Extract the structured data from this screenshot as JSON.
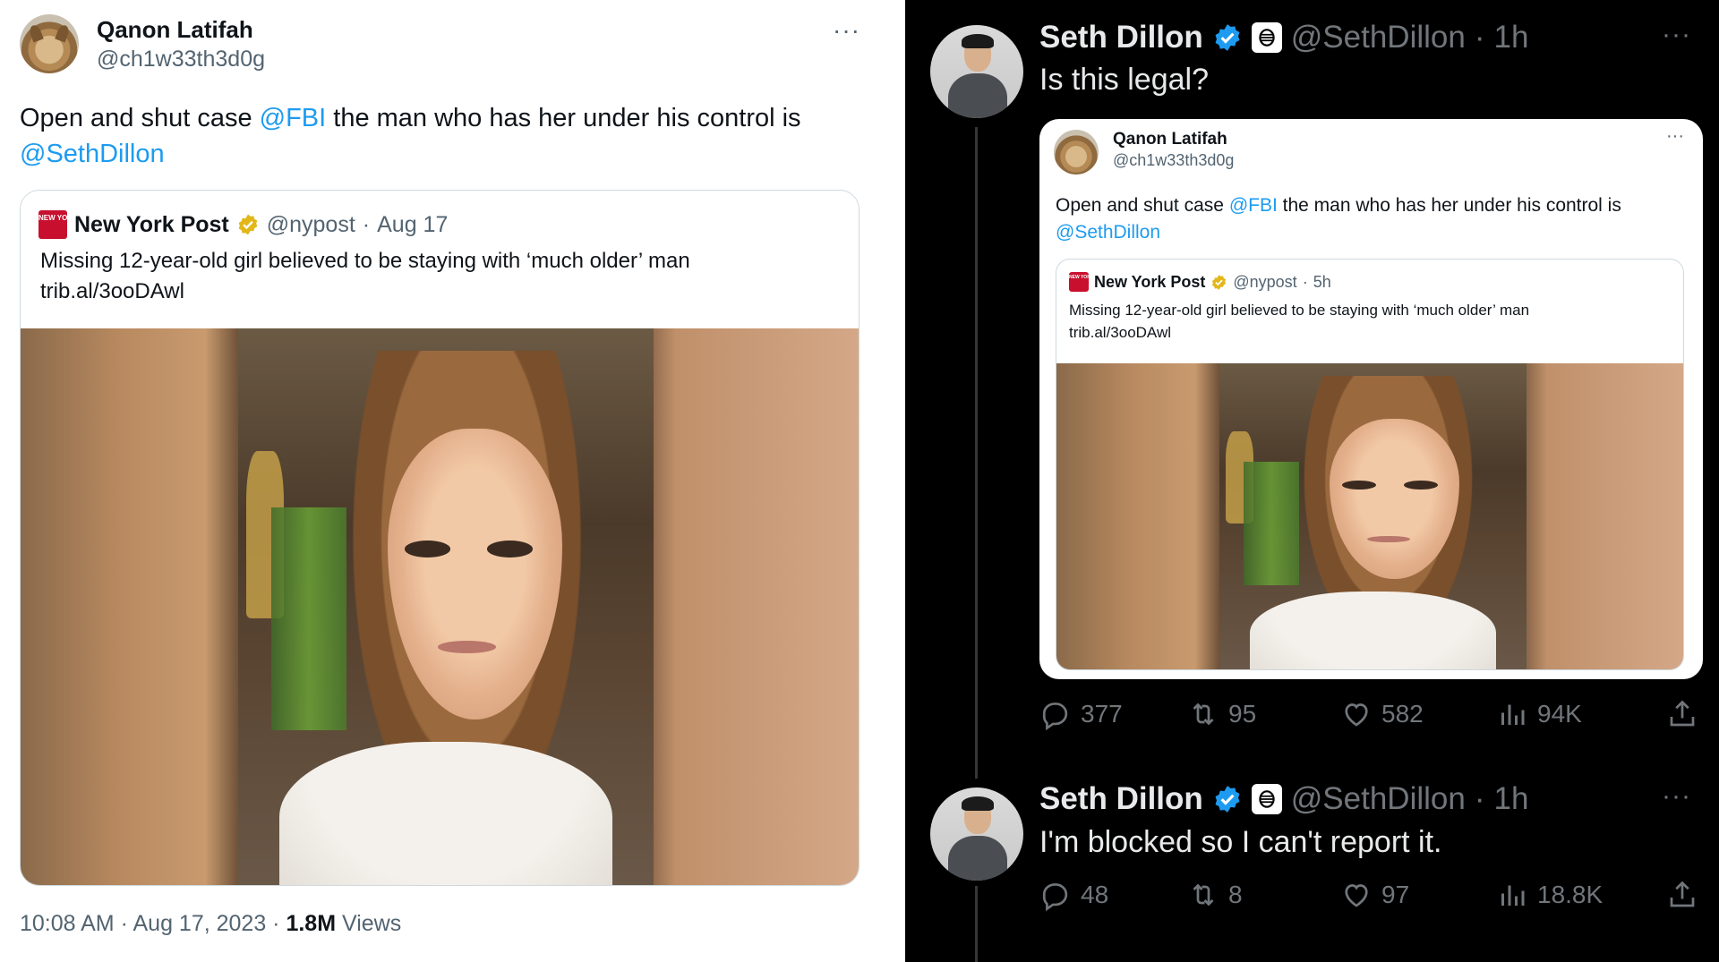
{
  "left_tweet": {
    "author_name": "Qanon Latifah",
    "author_handle": "@ch1w33th3d0g",
    "more": "···",
    "text_before": "Open and shut case ",
    "mention_fbi": "@FBI",
    "text_middle": " the man who has her under his control is",
    "mention_seth": "@SethDillon",
    "quote": {
      "logo_text": "NEW YORK POST",
      "name": "New York Post",
      "handle": "@nypost",
      "sep": "·",
      "date": "Aug 17",
      "text": "Missing 12-year-old girl believed to be staying with ‘much older’ man",
      "link": "trib.al/3ooDAwl"
    },
    "footer": {
      "time": "10:08 AM",
      "sep1": " · ",
      "date": "Aug 17, 2023",
      "sep2": " · ",
      "views_count": "1.8M",
      "views_label": " Views"
    }
  },
  "right_tweet": {
    "author_name": "Seth Dillon",
    "author_handle": "@SethDillon",
    "sep": "·",
    "time": "1h",
    "more": "···",
    "text": "Is this legal?",
    "embedded": {
      "author_name": "Qanon Latifah",
      "author_handle": "@ch1w33th3d0g",
      "more": "···",
      "text_before": "Open and shut case ",
      "mention_fbi": "@FBI",
      "text_middle": " the man who has her under his control is",
      "mention_seth": "@SethDillon",
      "quote": {
        "logo_text": "NEW YORK POST",
        "name": "New York Post",
        "handle": "@nypost",
        "sep": "·",
        "time": "5h",
        "text": "Missing 12-year-old girl believed to be staying with ‘much older’ man",
        "link": "trib.al/3ooDAwl"
      }
    },
    "actions": {
      "replies": "377",
      "reposts": "95",
      "likes": "582",
      "views": "94K"
    }
  },
  "reply_tweet": {
    "author_name": "Seth Dillon",
    "author_handle": "@SethDillon",
    "sep": "·",
    "time": "1h",
    "more": "···",
    "text": "I'm blocked so I can't report it.",
    "actions": {
      "replies": "48",
      "reposts": "8",
      "likes": "97",
      "views": "18.8K"
    }
  },
  "colors": {
    "link": "#1d9bf0",
    "muted_light": "#536471",
    "muted_dark": "#71767b",
    "verified_gold": "#e2b719",
    "verified_blue": "#1d9bf0",
    "nypost_red": "#c8102e"
  },
  "icons": [
    "more-icon",
    "nypost-logo-icon",
    "gold-verified-icon",
    "blue-verified-icon",
    "bee-badge-icon",
    "reply-icon",
    "repost-icon",
    "like-icon",
    "views-icon",
    "share-icon"
  ]
}
